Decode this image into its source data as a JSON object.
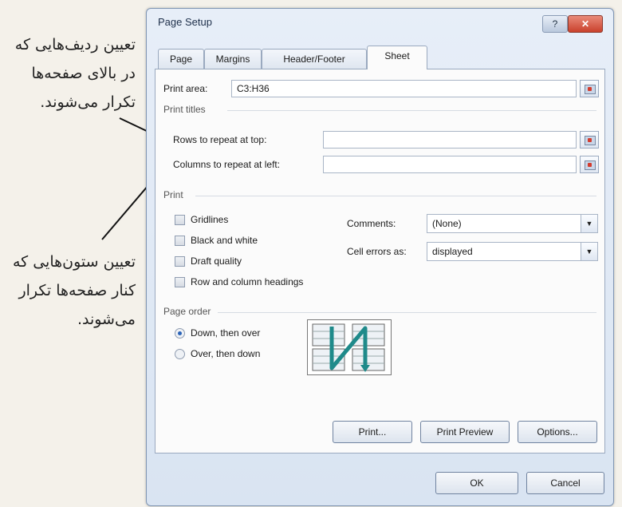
{
  "annotations": {
    "top": "تعیین ردیف‌هایی که در بالای صفحه‌ها تکرار می‌شوند.",
    "bottom": "تعیین ستون‌هایی که کنار صفحه‌ها تکرار می‌شوند."
  },
  "dialog": {
    "title": "Page Setup",
    "help_label": "?",
    "close_label": "✕"
  },
  "tabs": [
    {
      "label": "Page",
      "active": false
    },
    {
      "label": "Margins",
      "active": false
    },
    {
      "label": "Header/Footer",
      "active": false
    },
    {
      "label": "Sheet",
      "active": true
    }
  ],
  "sheet": {
    "print_area": {
      "label": "Print area:",
      "value": "C3:H36"
    },
    "print_titles": {
      "heading": "Print titles",
      "rows_label": "Rows to repeat at top:",
      "rows_value": "",
      "cols_label": "Columns to repeat at left:",
      "cols_value": ""
    },
    "print": {
      "heading": "Print",
      "checkboxes": [
        {
          "label": "Gridlines",
          "checked": false
        },
        {
          "label": "Black and white",
          "checked": false
        },
        {
          "label": "Draft quality",
          "checked": false
        },
        {
          "label": "Row and column headings",
          "checked": false
        }
      ],
      "comments": {
        "label": "Comments:",
        "value": "(None)"
      },
      "cell_errors": {
        "label": "Cell errors as:",
        "value": "displayed"
      }
    },
    "page_order": {
      "heading": "Page order",
      "options": [
        {
          "label": "Down, then over",
          "selected": true
        },
        {
          "label": "Over, then down",
          "selected": false
        }
      ]
    }
  },
  "buttons": {
    "print": "Print...",
    "print_preview": "Print Preview",
    "options": "Options...",
    "ok": "OK",
    "cancel": "Cancel"
  },
  "colors": {
    "accent": "#2a63b8",
    "preview_arrow": "#1f8a8a",
    "close": "#c9412c"
  }
}
